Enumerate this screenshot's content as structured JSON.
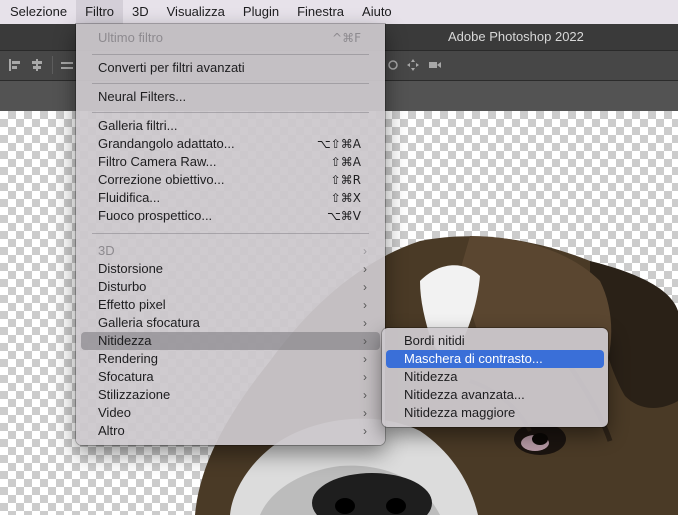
{
  "menubar": {
    "items": [
      "Selezione",
      "Filtro",
      "3D",
      "Visualizza",
      "Plugin",
      "Finestra",
      "Aiuto"
    ],
    "active_index": 1
  },
  "app": {
    "title": "Adobe Photoshop 2022"
  },
  "filter_menu": {
    "last_filter": {
      "label": "Ultimo filtro",
      "shortcut": "^⌘F"
    },
    "convert_smart": "Converti per filtri avanzati",
    "neural_filters": "Neural Filters...",
    "filter_gallery": "Galleria filtri...",
    "adaptive_wide_angle": {
      "label": "Grandangolo adattato...",
      "shortcut": "⌥⇧⌘A"
    },
    "camera_raw": {
      "label": "Filtro Camera Raw...",
      "shortcut": "⇧⌘A"
    },
    "lens_correction": {
      "label": "Correzione obiettivo...",
      "shortcut": "⇧⌘R"
    },
    "liquify": {
      "label": "Fluidifica...",
      "shortcut": "⇧⌘X"
    },
    "vanishing_point": {
      "label": "Fuoco prospettico...",
      "shortcut": "⌥⌘V"
    },
    "submenus": {
      "d3": "3D",
      "distort": "Distorsione",
      "noise": "Disturbo",
      "pixelate": "Effetto pixel",
      "blur_gallery": "Galleria sfocatura",
      "sharpen": "Nitidezza",
      "render": "Rendering",
      "blur": "Sfocatura",
      "stylize": "Stilizzazione",
      "video": "Video",
      "other": "Altro"
    },
    "arrow": "›"
  },
  "sharpen_submenu": {
    "items": [
      "Bordi nitidi",
      "Maschera di contrasto...",
      "Nitidezza",
      "Nitidezza avanzata...",
      "Nitidezza maggiore"
    ],
    "selected_index": 1,
    "selection_color": "#3a6fd8"
  }
}
